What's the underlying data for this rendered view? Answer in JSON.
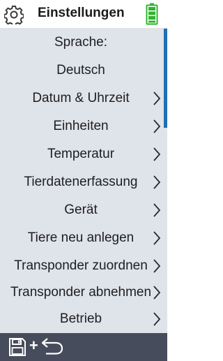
{
  "header": {
    "title": "Einstellungen",
    "icons": {
      "settings": "gear-icon",
      "battery": "battery-icon"
    },
    "battery_color": "#2fb52f"
  },
  "menu": {
    "items": [
      {
        "label": "Sprache:"
      },
      {
        "label": "Deutsch"
      },
      {
        "label": "Datum & Uhrzeit"
      },
      {
        "label": "Einheiten"
      },
      {
        "label": "Temperatur"
      },
      {
        "label": "Tierdatenerfassung"
      },
      {
        "label": "Gerät"
      },
      {
        "label": "Tiere neu anlegen"
      },
      {
        "label": "Transponder zuordnen"
      },
      {
        "label": "Transponder abnehmen"
      },
      {
        "label": "Betrieb"
      }
    ]
  },
  "footer": {
    "plus": "+",
    "icons": {
      "save": "save-icon",
      "undo": "undo-icon"
    }
  },
  "colors": {
    "menu_bg": "#dfe3ea",
    "footer_bg": "#474c5c",
    "scrollbar": "#1f6fb5"
  }
}
